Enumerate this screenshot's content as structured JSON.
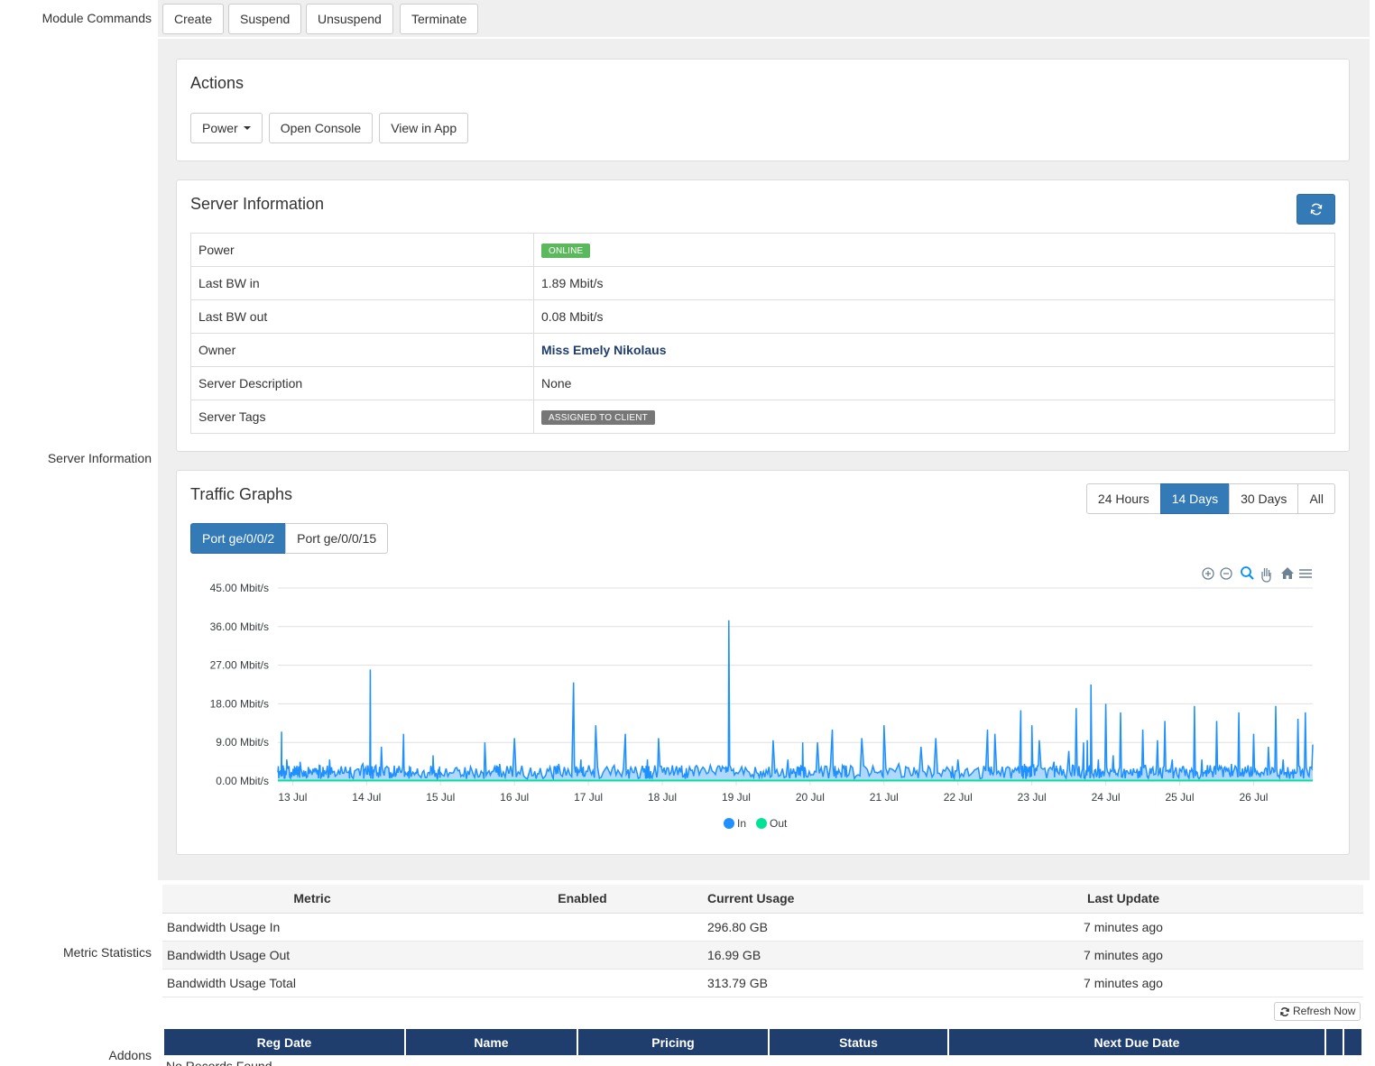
{
  "labels": {
    "module_commands": "Module Commands",
    "server_information": "Server Information",
    "metric_statistics": "Metric Statistics",
    "addons": "Addons"
  },
  "module_commands": {
    "create": "Create",
    "suspend": "Suspend",
    "unsuspend": "Unsuspend",
    "terminate": "Terminate"
  },
  "actions": {
    "title": "Actions",
    "power": "Power",
    "open_console": "Open Console",
    "view_in_app": "View in App"
  },
  "server_info": {
    "title": "Server Information",
    "rows": [
      {
        "key": "Power",
        "value": "ONLINE"
      },
      {
        "key": "Last BW in",
        "value": "1.89 Mbit/s"
      },
      {
        "key": "Last BW out",
        "value": "0.08 Mbit/s"
      },
      {
        "key": "Owner",
        "value": "Miss Emely Nikolaus"
      },
      {
        "key": "Server Description",
        "value": "None"
      },
      {
        "key": "Server Tags",
        "value": "ASSIGNED TO CLIENT"
      }
    ],
    "colors": {
      "online": "#5cb85c",
      "tag": "#777777",
      "owner": "#1f3e6e"
    }
  },
  "traffic": {
    "title": "Traffic Graphs",
    "ranges": [
      "24 Hours",
      "14 Days",
      "30 Days",
      "All"
    ],
    "active_range": "14 Days",
    "ports": [
      "Port ge/0/0/2",
      "Port ge/0/0/15"
    ],
    "active_port": "Port ge/0/0/2"
  },
  "chart_data": {
    "type": "line",
    "title": "",
    "xlabel": "",
    "ylabel": "",
    "y_unit": "Mbit/s",
    "ylim": [
      0,
      45
    ],
    "y_ticks": [
      "45.00 Mbit/s",
      "36.00 Mbit/s",
      "27.00 Mbit/s",
      "18.00 Mbit/s",
      "9.00 Mbit/s",
      "0.00 Mbit/s"
    ],
    "x_ticks": [
      "13 Jul",
      "14 Jul",
      "15 Jul",
      "16 Jul",
      "17 Jul",
      "18 Jul",
      "19 Jul",
      "20 Jul",
      "21 Jul",
      "22 Jul",
      "23 Jul",
      "24 Jul",
      "25 Jul",
      "26 Jul"
    ],
    "x_range_days": [
      12.8,
      26.8
    ],
    "legend": {
      "position": "bottom",
      "entries": [
        "In",
        "Out"
      ]
    },
    "grid": true,
    "series": [
      {
        "name": "In",
        "color": "#1e90ff",
        "x": [
          12.8,
          12.85,
          12.88,
          12.92,
          13.0,
          13.05,
          13.1,
          13.2,
          13.3,
          13.38,
          13.42,
          13.5,
          13.6,
          13.75,
          13.8,
          13.95,
          14.0,
          14.05,
          14.1,
          14.2,
          14.3,
          14.4,
          14.5,
          14.55,
          14.6,
          14.7,
          14.85,
          14.9,
          14.95,
          15.0,
          15.2,
          15.35,
          15.5,
          15.6,
          15.75,
          15.8,
          16.0,
          16.2,
          16.35,
          16.5,
          16.6,
          16.8,
          16.9,
          16.95,
          17.1,
          17.3,
          17.5,
          17.6,
          17.75,
          17.8,
          17.85,
          17.95,
          18.1,
          18.25,
          18.35,
          18.5,
          18.7,
          18.85,
          18.9,
          19.0,
          19.2,
          19.35,
          19.5,
          19.7,
          19.8,
          19.85,
          19.9,
          19.95,
          20.1,
          20.3,
          20.4,
          20.5,
          20.7,
          20.9,
          21.0,
          21.2,
          21.35,
          21.5,
          21.7,
          21.9,
          22.0,
          22.2,
          22.4,
          22.5,
          22.7,
          22.85,
          22.9,
          22.95,
          23.0,
          23.1,
          23.3,
          23.35,
          23.5,
          23.6,
          23.7,
          23.75,
          23.8,
          23.9,
          24.0,
          24.1,
          24.2,
          24.3,
          24.4,
          24.5,
          24.6,
          24.7,
          24.8,
          24.9,
          25.0,
          25.1,
          25.2,
          25.3,
          25.4,
          25.5,
          25.6,
          25.7,
          25.8,
          25.9,
          26.0,
          26.1,
          26.2,
          26.3,
          26.4,
          26.5,
          26.6,
          26.7,
          26.8
        ],
        "y": [
          2,
          11.5,
          3,
          5,
          2,
          1.5,
          4.5,
          1,
          3,
          0.5,
          1,
          5,
          1.5,
          2,
          1,
          4,
          1.5,
          26,
          2,
          8,
          3,
          1.5,
          11,
          2,
          1,
          1.5,
          2,
          6,
          1,
          2,
          3,
          0.5,
          1.5,
          9,
          2,
          4,
          10,
          2,
          3,
          2,
          4,
          23,
          5,
          1,
          13,
          1.5,
          11,
          2,
          2,
          5,
          1,
          10,
          1.5,
          2,
          1.5,
          1.5,
          2,
          3,
          37.5,
          2,
          1,
          1,
          9.5,
          5,
          2,
          2,
          9,
          1,
          9,
          12,
          2,
          1,
          10,
          2,
          13,
          4,
          2,
          8,
          10,
          2,
          5,
          2,
          12,
          11,
          3,
          16.5,
          4,
          2,
          13,
          9.5,
          4.5,
          2,
          7,
          17,
          9,
          9.5,
          22.5,
          5,
          18,
          6,
          16,
          2,
          2,
          12,
          3,
          9.5,
          14,
          5,
          3,
          2,
          17.5,
          5,
          2,
          14,
          3,
          4,
          16,
          2,
          11,
          2,
          8,
          17.5,
          5,
          2,
          14.5,
          16,
          8.5
        ]
      },
      {
        "name": "Out",
        "color": "#00e396",
        "x": [
          12.8,
          26.8
        ],
        "y": [
          0.1,
          0.1
        ]
      }
    ]
  },
  "metrics": {
    "headers": [
      "Metric",
      "Enabled",
      "Current Usage",
      "Last Update"
    ],
    "rows": [
      {
        "metric": "Bandwidth Usage In",
        "enabled": "",
        "usage": "296.80 GB",
        "updated": "7 minutes ago"
      },
      {
        "metric": "Bandwidth Usage Out",
        "enabled": "",
        "usage": "16.99 GB",
        "updated": "7 minutes ago"
      },
      {
        "metric": "Bandwidth Usage Total",
        "enabled": "",
        "usage": "313.79 GB",
        "updated": "7 minutes ago"
      }
    ],
    "refresh_label": "Refresh Now"
  },
  "addons": {
    "headers": [
      "Reg Date",
      "Name",
      "Pricing",
      "Status",
      "Next Due Date",
      "",
      ""
    ],
    "empty_text": "No Records Found"
  }
}
